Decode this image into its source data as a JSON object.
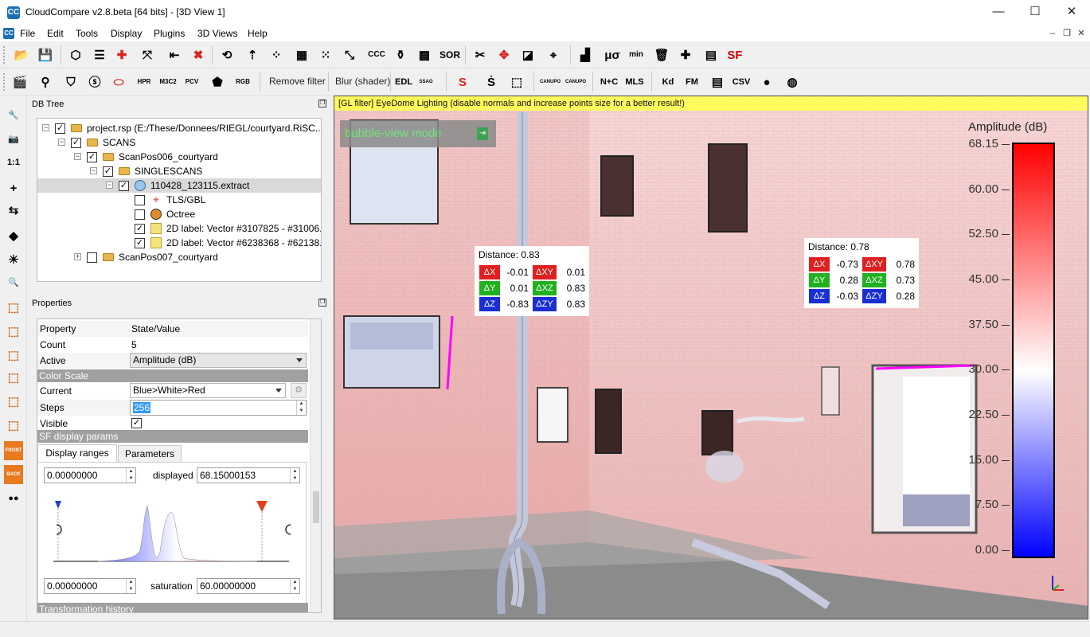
{
  "window": {
    "title": "CloudCompare v2.8.beta [64 bits] - [3D View 1]",
    "minimize": "—",
    "maximize": "☐",
    "close": "✕"
  },
  "menu": {
    "items": [
      "File",
      "Edit",
      "Tools",
      "Display",
      "Plugins",
      "3D Views",
      "Help"
    ],
    "mdi_minimize": "–",
    "mdi_restore": "❐",
    "mdi_close": "✕"
  },
  "toolbar1": {
    "icons": [
      {
        "name": "open-icon",
        "glyph": "📂"
      },
      {
        "name": "save-icon",
        "glyph": "💾"
      },
      {
        "name": "clone-icon",
        "glyph": "⬡"
      },
      {
        "name": "properties-list-icon",
        "glyph": "☰"
      },
      {
        "name": "merge-icon",
        "glyph": "✚"
      },
      {
        "name": "register-icon",
        "glyph": "⤧"
      },
      {
        "name": "align-icon",
        "glyph": "⇤"
      },
      {
        "name": "delete-icon",
        "glyph": "✖"
      },
      {
        "name": "convert-icon",
        "glyph": "⟲"
      },
      {
        "name": "fit-icon",
        "glyph": "⇡"
      },
      {
        "name": "sample-points-icon",
        "glyph": "⁘"
      },
      {
        "name": "subsample-icon",
        "glyph": "▦"
      },
      {
        "name": "noise-icon",
        "glyph": "⁙"
      },
      {
        "name": "crop-icon",
        "glyph": "⤡"
      },
      {
        "name": "cloud-cloud-distance-icon",
        "glyph": "CCC"
      },
      {
        "name": "sf-tool-icon",
        "glyph": "⚱"
      },
      {
        "name": "checker-icon",
        "glyph": "▩"
      },
      {
        "name": "sor-filter-icon",
        "glyph": "SOR"
      },
      {
        "name": "segment-icon",
        "glyph": "✂"
      },
      {
        "name": "translate-rotate-icon",
        "glyph": "✥"
      },
      {
        "name": "cross-section-icon",
        "glyph": "◪"
      },
      {
        "name": "point-picking-icon",
        "glyph": "⌖"
      },
      {
        "name": "histogram-icon",
        "glyph": "▟"
      },
      {
        "name": "gaussian-fit-icon",
        "glyph": "μσ"
      },
      {
        "name": "min-max-icon",
        "glyph": "min"
      },
      {
        "name": "trash-sf-icon",
        "glyph": "🗑"
      },
      {
        "name": "add-sf-icon",
        "glyph": "✚"
      },
      {
        "name": "calculator-icon",
        "glyph": "▤"
      },
      {
        "name": "sf-icon",
        "glyph": "SF"
      }
    ]
  },
  "toolbar2": {
    "icons_left": [
      {
        "name": "clapper-icon",
        "glyph": "🎬"
      },
      {
        "name": "brush-icon",
        "glyph": "⚲"
      },
      {
        "name": "shield-icon",
        "glyph": "⛉"
      },
      {
        "name": "sf-shader-icon",
        "glyph": "ⓢ"
      },
      {
        "name": "ellipse-icon",
        "glyph": "⬭"
      },
      {
        "name": "hpr-icon",
        "glyph": "HPR"
      },
      {
        "name": "m3c2-icon",
        "glyph": "M3C2"
      },
      {
        "name": "pcv-icon",
        "glyph": "PCV"
      },
      {
        "name": "pentagon-icon",
        "glyph": "⬟"
      },
      {
        "name": "rgb-icon",
        "glyph": "RGB"
      }
    ],
    "remove_filter": "Remove filter",
    "blur_shader": "Blur (shader)",
    "icons_right": [
      {
        "name": "edl-icon",
        "glyph": "EDL"
      },
      {
        "name": "ssao-icon",
        "glyph": "SSAO"
      },
      {
        "name": "s-tool-icon",
        "glyph": "S"
      },
      {
        "name": "s-alt-icon",
        "glyph": "Ṡ"
      },
      {
        "name": "cube-tool-icon",
        "glyph": "⬚"
      },
      {
        "name": "canupo-create-icon",
        "glyph": "CANUPO"
      },
      {
        "name": "canupo-classify-icon",
        "glyph": "CANUPO"
      },
      {
        "name": "n-plus-c-icon",
        "glyph": "N+C"
      },
      {
        "name": "mls-icon",
        "glyph": "MLS"
      },
      {
        "name": "kd-icon",
        "glyph": "Kd"
      },
      {
        "name": "fm-icon",
        "glyph": "FM"
      },
      {
        "name": "bdp-icon",
        "glyph": "▤"
      },
      {
        "name": "csv-icon",
        "glyph": "CSV"
      },
      {
        "name": "sphere-icon",
        "glyph": "●"
      },
      {
        "name": "globe-icon",
        "glyph": "◍"
      }
    ]
  },
  "leftbar": [
    {
      "name": "wrench-icon",
      "glyph": "🔧"
    },
    {
      "name": "camera-icon",
      "glyph": "📷"
    },
    {
      "name": "zoom-1to1-icon",
      "glyph": "1:1"
    },
    {
      "name": "pivot-icon",
      "glyph": "+"
    },
    {
      "name": "rotate-icon",
      "glyph": "⇆"
    },
    {
      "name": "perspective-icon",
      "glyph": "◆"
    },
    {
      "name": "lights-icon",
      "glyph": "☀"
    },
    {
      "name": "zoom-icon",
      "glyph": "🔍"
    },
    {
      "name": "view-iso1-icon",
      "glyph": "⬚"
    },
    {
      "name": "view-top-icon",
      "glyph": "⬚"
    },
    {
      "name": "view-bottom-icon",
      "glyph": "⬚"
    },
    {
      "name": "view-front-icon",
      "glyph": "⬚"
    },
    {
      "name": "view-left-icon",
      "glyph": "⬚"
    },
    {
      "name": "view-right-icon",
      "glyph": "⬚"
    },
    {
      "name": "front-view-icon",
      "glyph": "FRONT"
    },
    {
      "name": "back-view-icon",
      "glyph": "BACK"
    },
    {
      "name": "stereo-icon",
      "glyph": "●●"
    }
  ],
  "dbtree": {
    "header": "DB Tree",
    "rows": [
      {
        "label": "project.rsp (E:/These/Donnees/RIEGL/courtyard.RiSC...",
        "expander": "⊟",
        "checked": true,
        "icon": "folder"
      },
      {
        "label": "SCANS",
        "expander": "⊟",
        "checked": true,
        "icon": "folder"
      },
      {
        "label": "ScanPos006_courtyard",
        "expander": "⊟",
        "checked": true,
        "icon": "folder"
      },
      {
        "label": "SINGLESCANS",
        "expander": "⊟",
        "checked": true,
        "icon": "folder"
      },
      {
        "label": "110428_123115.extract",
        "expander": "⊟",
        "checked": true,
        "icon": "cloud"
      },
      {
        "label": "TLS/GBL",
        "expander": "",
        "checked": false,
        "icon": "sensor"
      },
      {
        "label": "Octree",
        "expander": "",
        "checked": false,
        "icon": "octree"
      },
      {
        "label": "2D label: Vector #3107825 - #31006...",
        "expander": "",
        "checked": true,
        "icon": "label"
      },
      {
        "label": "2D label: Vector #6238368 - #62138...",
        "expander": "",
        "checked": true,
        "icon": "label"
      },
      {
        "label": "ScanPos007_courtyard",
        "expander": "⊞",
        "checked": false,
        "icon": "folder"
      }
    ]
  },
  "properties": {
    "header": "Properties",
    "col_property": "Property",
    "col_value": "State/Value",
    "count_label": "Count",
    "count_value": "5",
    "active_label": "Active",
    "active_value": "Amplitude (dB)",
    "color_scale_section": "Color Scale",
    "current_label": "Current",
    "current_value": "Blue>White>Red",
    "steps_label": "Steps",
    "steps_value": "256",
    "visible_label": "Visible",
    "visible_checked": "✓",
    "sf_section": "SF display params",
    "tab_display": "Display ranges",
    "tab_parameters": "Parameters",
    "range_min": "0.00000000",
    "displayed_label": "displayed",
    "displayed_value": "68.15000153",
    "sat_min": "0.00000000",
    "saturation_label": "saturation",
    "saturation_value": "60.00000000",
    "transformation_section": "Transformation history"
  },
  "view3d": {
    "filter_banner": "[GL filter] EyeDome Lighting (disable normals and increase points size for a better result!)",
    "bubble_mode": "bubble-view mode",
    "label1": {
      "title": "Distance: 0.83",
      "dx": "-0.01",
      "dy": "0.01",
      "dz": "-0.83",
      "dxy": "0.01",
      "dxz": "0.83",
      "dzy": "0.83"
    },
    "label2": {
      "title": "Distance: 0.78",
      "dx": "-0.73",
      "dy": "0.28",
      "dz": "-0.03",
      "dxy": "0.78",
      "dxz": "0.73",
      "dzy": "0.28"
    },
    "delta_labels": {
      "x": "ΔX",
      "y": "ΔY",
      "z": "ΔZ",
      "xy": "ΔXY",
      "xz": "ΔXZ",
      "zy": "ΔZY"
    },
    "colors": {
      "dx": "#e02020",
      "dy": "#20b020",
      "dz": "#1a2fd0"
    }
  },
  "colorbar": {
    "title": "Amplitude (dB)",
    "ticks": [
      "68.15",
      "60.00",
      "52.50",
      "45.00",
      "37.50",
      "30.00",
      "22.50",
      "15.00",
      "7.50",
      "0.00"
    ],
    "gradient": [
      "#ff0000",
      "#ffffff",
      "#0000ff"
    ]
  }
}
